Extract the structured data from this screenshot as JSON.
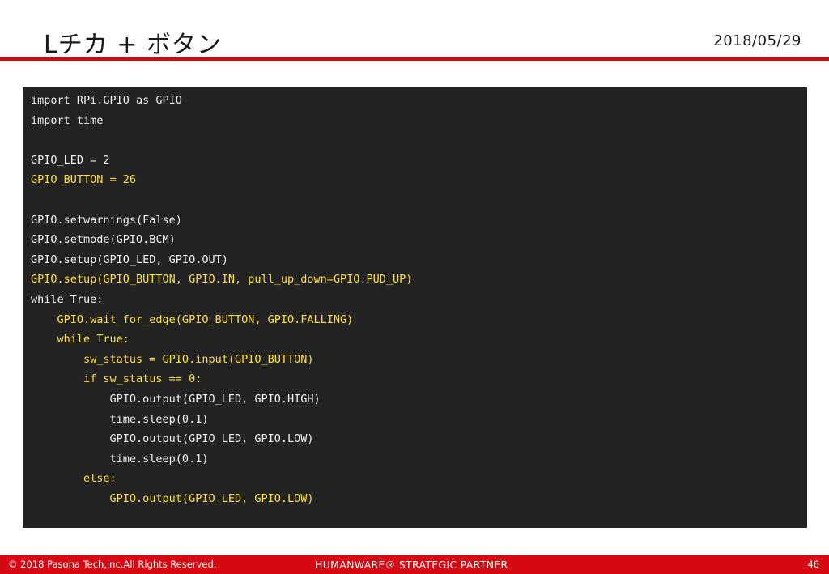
{
  "slide": {
    "title": "Lチカ + ボタン",
    "date": "2018/05/29"
  },
  "code": {
    "lines": [
      {
        "text": "import RPi.GPIO as GPIO",
        "highlight": false
      },
      {
        "text": "import time",
        "highlight": false
      },
      {
        "text": "",
        "highlight": false
      },
      {
        "text": "GPIO_LED = 2",
        "highlight": false
      },
      {
        "text": "GPIO_BUTTON = 26",
        "highlight": true
      },
      {
        "text": "",
        "highlight": false
      },
      {
        "text": "GPIO.setwarnings(False)",
        "highlight": false
      },
      {
        "text": "GPIO.setmode(GPIO.BCM)",
        "highlight": false
      },
      {
        "text": "GPIO.setup(GPIO_LED, GPIO.OUT)",
        "highlight": false
      },
      {
        "text": "GPIO.setup(GPIO_BUTTON, GPIO.IN, pull_up_down=GPIO.PUD_UP)",
        "highlight": true
      },
      {
        "text": "while True:",
        "highlight": false
      },
      {
        "text": "    GPIO.wait_for_edge(GPIO_BUTTON, GPIO.FALLING)",
        "highlight": true
      },
      {
        "text": "    while True:",
        "highlight": true
      },
      {
        "text": "        sw_status = GPIO.input(GPIO_BUTTON)",
        "highlight": true
      },
      {
        "text": "        if sw_status == 0:",
        "highlight": true
      },
      {
        "text": "            GPIO.output(GPIO_LED, GPIO.HIGH)",
        "highlight": false
      },
      {
        "text": "            time.sleep(0.1)",
        "highlight": false
      },
      {
        "text": "            GPIO.output(GPIO_LED, GPIO.LOW)",
        "highlight": false
      },
      {
        "text": "            time.sleep(0.1)",
        "highlight": false
      },
      {
        "text": "        else:",
        "highlight": true
      },
      {
        "text": "            GPIO.output(GPIO_LED, GPIO.LOW)",
        "highlight": true
      }
    ]
  },
  "footer": {
    "copyright": "© 2018 Pasona Tech,inc.All Rights Reserved.",
    "tagline": "HUMANWARE® STRATEGIC PARTNER",
    "page_number": "46"
  },
  "colors": {
    "accent_red": "#d60812",
    "code_background": "#232323",
    "code_text": "#f0f0f0",
    "code_highlight": "#ffe033"
  }
}
